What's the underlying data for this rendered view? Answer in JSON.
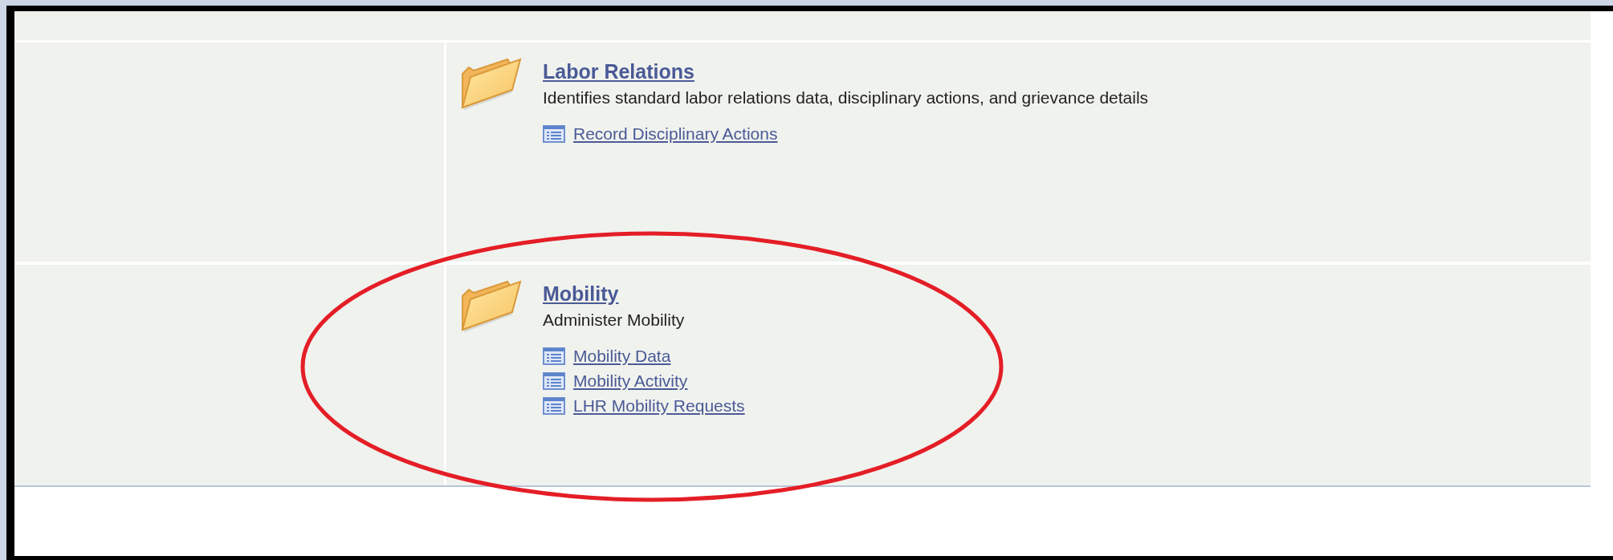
{
  "categories": [
    {
      "title": "Labor Relations",
      "description": "Identifies standard labor relations data, disciplinary actions, and grievance details",
      "links": [
        "Record Disciplinary Actions"
      ]
    },
    {
      "title": "Mobility",
      "description": "Administer Mobility",
      "links": [
        "Mobility Data",
        "Mobility Activity",
        "LHR Mobility Requests"
      ]
    }
  ]
}
